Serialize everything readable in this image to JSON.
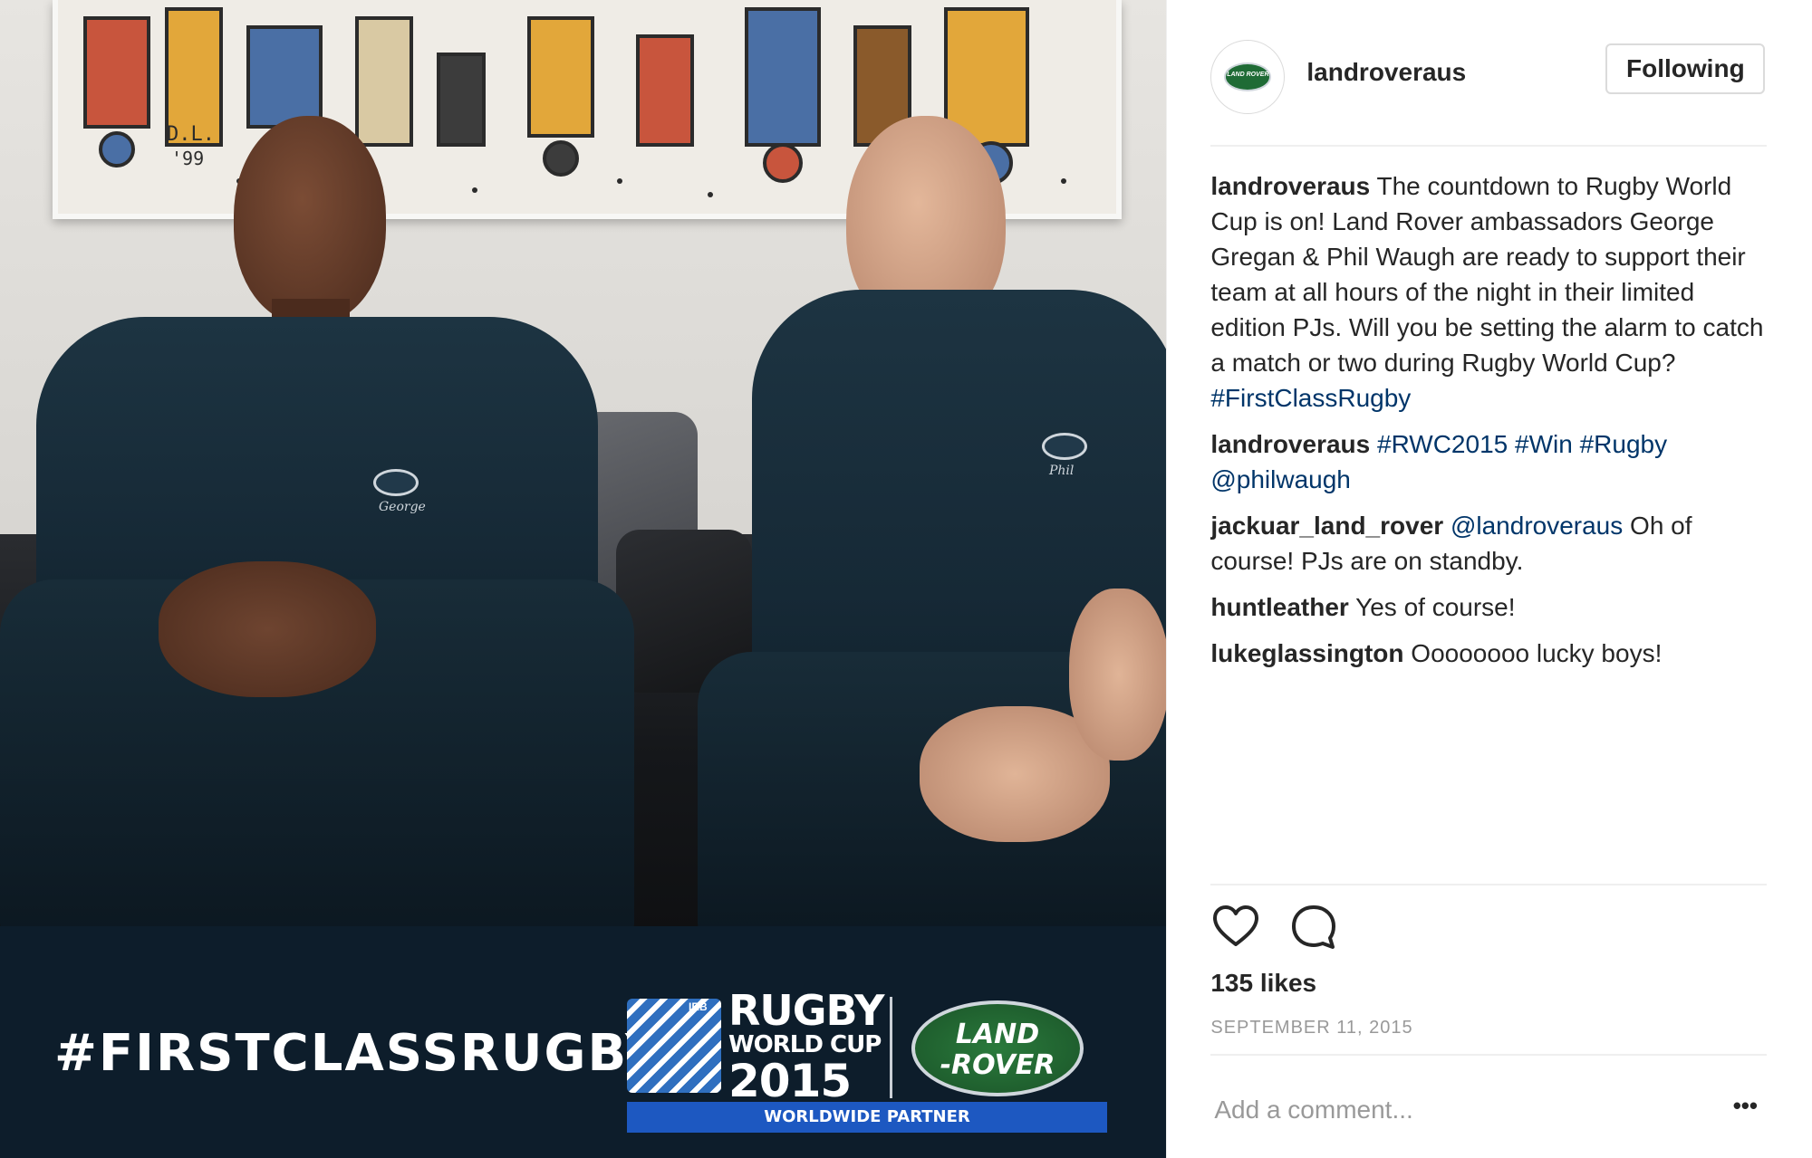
{
  "post": {
    "image": {
      "hashtag_banner": "#FIRSTCLASSRUGBY",
      "painting_initials": "D.L.",
      "painting_year": "'99",
      "rwc_logo": {
        "irb": "IRB",
        "line1": "RUGBY",
        "line2": "WORLD CUP",
        "line3": "2015",
        "partner": "WORLDWIDE PARTNER"
      },
      "sponsor_logo": {
        "line1": "LAND",
        "line2": "-ROVER"
      },
      "shirt_names": [
        "George",
        "Phil"
      ]
    },
    "header": {
      "username": "landroveraus",
      "avatar_label": "LAND ROVER",
      "follow_label": "Following"
    },
    "comments": [
      {
        "user": "landroveraus",
        "text": "The countdown to Rugby World Cup is on! Land Rover ambassadors George Gregan & Phil Waugh are ready to support their team at all hours of the night in their limited edition PJs. Will you be setting the alarm to catch a match or two during Rugby World Cup?",
        "tag": "#FirstClassRugby"
      },
      {
        "user": "landroveraus",
        "tags": [
          "#RWC2015",
          "#Win",
          "#Rugby",
          "@philwaugh"
        ]
      },
      {
        "user": "jackuar_land_rover",
        "mention": "@landroveraus",
        "text": "Oh of course! PJs are on standby."
      },
      {
        "user": "huntleather",
        "text": "Yes of course!"
      },
      {
        "user": "lukeglassington",
        "text": "Oooooooo lucky boys!"
      }
    ],
    "actions": {
      "like_icon": "heart-icon",
      "comment_icon": "speech-bubble-icon"
    },
    "likes": "135 likes",
    "date": "SEPTEMBER 11, 2015",
    "add_comment": {
      "placeholder": "Add a comment...",
      "more_label": "•••"
    }
  },
  "colors": {
    "link": "#003569",
    "muted": "#999999",
    "border": "#efefef",
    "banner": "#0d1d2b"
  }
}
